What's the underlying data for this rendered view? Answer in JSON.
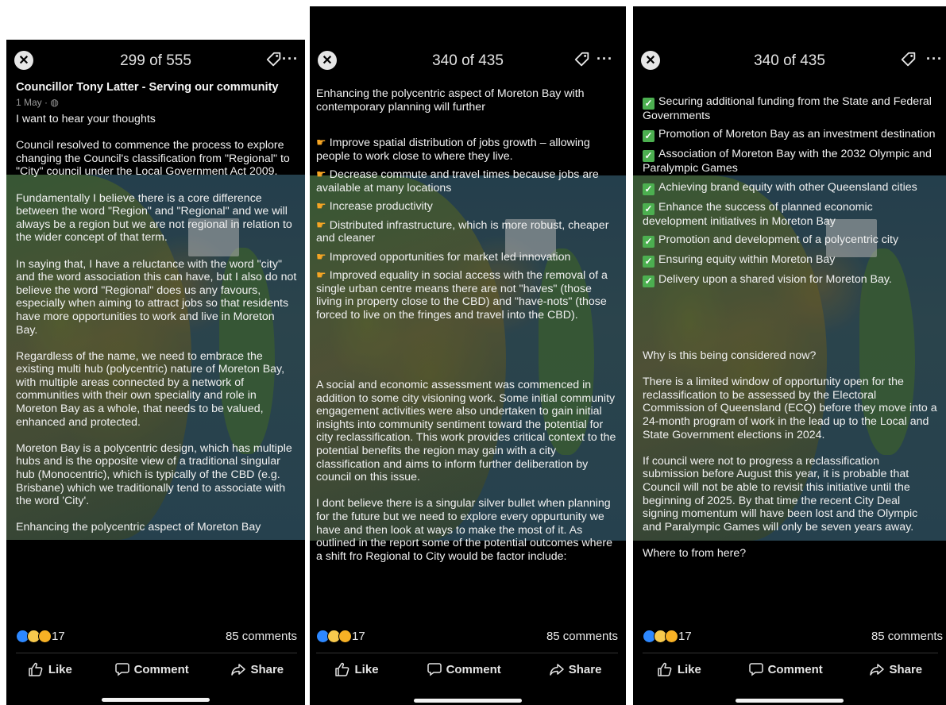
{
  "panels": [
    {
      "counter": "299 of 555",
      "author": "Councillor Tony Latter - Serving our community",
      "meta": "1 May · ",
      "text": "I want to hear your thoughts\n\nCouncil resolved to commence the process to explore changing the Council's classification from \"Regional\" to \"City\" council under the Local Government Act 2009.\n\nFundamentally I believe there is a core difference between the word \"Region\" and \"Regional\" and we will always be a region but we are not regional in relation to the wider concept of that term.\n\nIn saying that, I have a reluctance with the word \"city\" and the word association this can have, but I also do not believe the word \"Regional\" does us any favours, especially when aiming to attract jobs so that residents have more opportunities to work and live in Moreton Bay.\n\nRegardless of the name, we need to embrace the existing multi hub (polycentric) nature of Moreton Bay, with multiple areas connected by a network of communities with their own speciality and role in Moreton Bay as a whole, that needs to be valued, enhanced and protected.\n\nMoreton Bay is a polycentric design, which has multiple hubs and is the opposite view of a traditional singular hub (Monocentric), which is typically of the CBD (e.g. Brisbane) which we traditionally tend to associate with the word 'City'.\n\nEnhancing the polycentric aspect of Moreton Bay",
      "reaction_count": "17",
      "comments": "85 comments",
      "like": "Like",
      "comment": "Comment",
      "share": "Share"
    },
    {
      "counter": "340 of 435",
      "intro": "Enhancing the polycentric aspect of Moreton Bay with contemporary planning will further",
      "bullets": [
        "Improve spatial distribution of jobs growth – allowing people to work close to where they live.",
        "Decrease commute and travel times because jobs are available at many locations",
        "Increase productivity",
        "Distributed infrastructure, which is more robust, cheaper and cleaner",
        "Improved opportunities for market led innovation",
        "Improved equality in social access with the removal of a single urban centre means there are not \"haves\" (those living in property close to the CBD) and \"have-nots\" (those forced to live on the fringes and travel into the CBD)."
      ],
      "outro": "A social and economic assessment was commenced in addition to some city visioning work. Some initial community engagement activities were also undertaken to gain initial insights into community sentiment toward the potential for city reclassification. This work provides critical context to the potential benefits the region may gain with a city classification and aims to inform further deliberation by council on this issue.\n\nI dont believe there is a singular silver bullet when planning for the future but we need to explore every oppurtunity we have and then look at ways to make the most of it. As outlined in the report some of the potential outcomes where a shift fro Regional to City would be factor include:",
      "reaction_count": "17",
      "comments": "85 comments",
      "like": "Like",
      "comment": "Comment",
      "share": "Share"
    },
    {
      "counter": "340 of 435",
      "checks": [
        "Securing additional funding from the State and Federal Governments",
        "Promotion of Moreton Bay as an investment destination",
        "Association of Moreton Bay with the 2032 Olympic and Paralympic Games",
        "Achieving brand equity with other Queensland cities",
        "Enhance the success of planned economic development initiatives in Moreton Bay",
        "Promotion and development of a polycentric city",
        "Ensuring equity within Moreton Bay",
        "Delivery upon a shared vision for Moreton Bay."
      ],
      "outro": "Why is this being considered now?\n\nThere is a limited window of opportunity open for the reclassification to be assessed by the Electoral Commission of Queensland (ECQ) before they move into a 24-month program of work in the lead up to the Local and State Government elections in 2024.\n\nIf council were not to progress a reclassification submission before August this year, it is probable that Council will not be able to revisit this initiative until the beginning of 2025. By that time the recent City Deal signing momentum will have been lost and the Olympic and Paralympic Games will only be seven years away.\n\nWhere to from here?",
      "reaction_count": "17",
      "comments": "85 comments",
      "like": "Like",
      "comment": "Comment",
      "share": "Share"
    }
  ],
  "icons": {
    "close": "close-icon",
    "tag": "tag-icon",
    "more": "more-icon",
    "like": "thumbs-up-icon",
    "comment": "speech-bubble-icon",
    "share": "share-arrow-icon",
    "point": "pointing-hand-icon",
    "check": "check-mark-icon"
  },
  "colors": {
    "background": "#000000",
    "text": "#f0f0f0",
    "check": "#4caf50",
    "like_reaction": "#2d88ff",
    "haha_reaction": "#f7c94d"
  }
}
